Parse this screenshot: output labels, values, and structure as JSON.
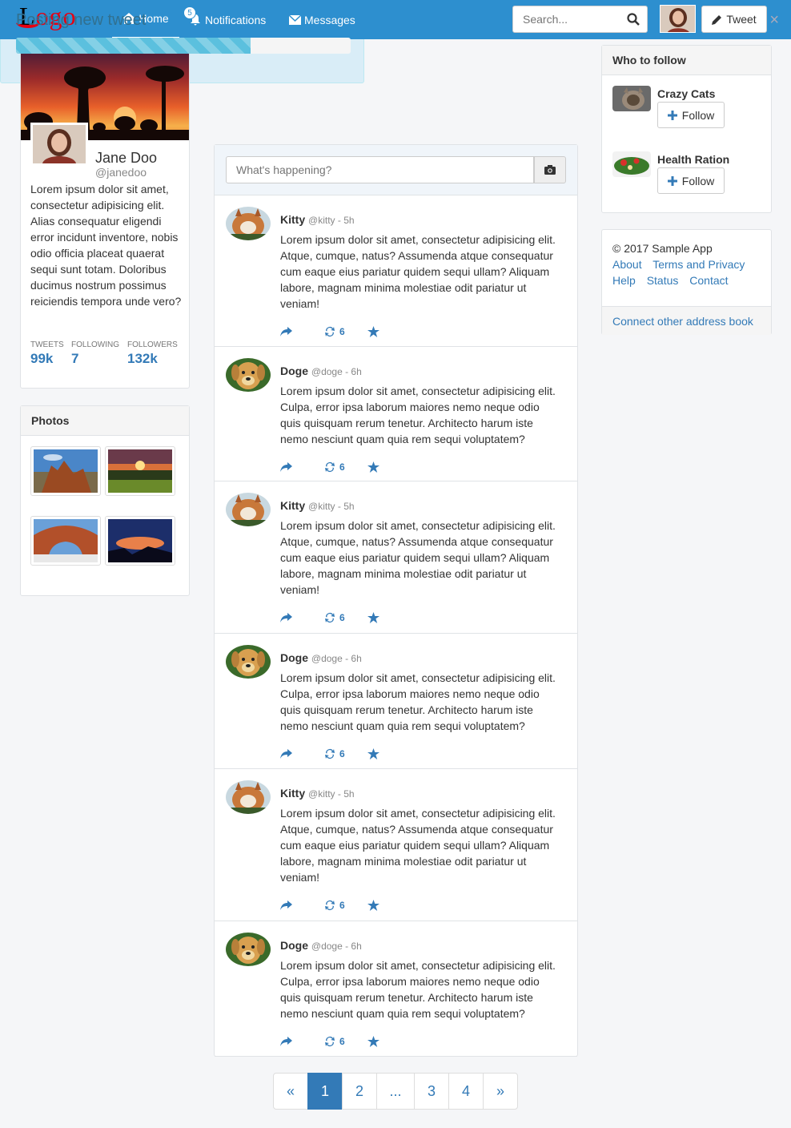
{
  "nav": {
    "logo_first": "L",
    "logo_rest": "ogo",
    "home": "Home",
    "notifications": "Notifications",
    "notifications_badge": "5",
    "messages": "Messages",
    "search_placeholder": "Search...",
    "tweet_button": "Tweet"
  },
  "profile": {
    "name": "Jane Doo",
    "handle": "@janedoo",
    "bio": "Lorem ipsum dolor sit amet, consectetur adipisicing elit. Alias consequatur eligendi error incidunt inventore, nobis odio officia placeat quaerat sequi sunt totam. Doloribus ducimus nostrum possimus reiciendis tempora unde vero?",
    "stats": [
      {
        "label": "TWEETS",
        "value": "99k"
      },
      {
        "label": "FOLLOWING",
        "value": "7"
      },
      {
        "label": "FOLLOWERS",
        "value": "132k"
      }
    ]
  },
  "photos": {
    "title": "Photos"
  },
  "posting": {
    "title": "Posting new tweet",
    "close": "×",
    "progress": 0.7
  },
  "compose": {
    "placeholder": "What's happening?"
  },
  "tweets": [
    {
      "author": "Kitty",
      "meta": "@kitty - 5h",
      "text": "Lorem ipsum dolor sit amet, consectetur adipisicing elit. Atque, cumque, natus? Assumenda atque consequatur cum eaque eius pariatur quidem sequi ullam? Aliquam labore, magnam minima molestiae odit pariatur ut veniam!",
      "retweets": "6"
    },
    {
      "author": "Doge",
      "meta": "@doge - 6h",
      "text": "Lorem ipsum dolor sit amet, consectetur adipisicing elit. Culpa, error ipsa laborum maiores nemo neque odio quis quisquam rerum tenetur. Architecto harum iste nemo nesciunt quam quia rem sequi voluptatem?",
      "retweets": "6"
    },
    {
      "author": "Kitty",
      "meta": "@kitty - 5h",
      "text": "Lorem ipsum dolor sit amet, consectetur adipisicing elit. Atque, cumque, natus? Assumenda atque consequatur cum eaque eius pariatur quidem sequi ullam? Aliquam labore, magnam minima molestiae odit pariatur ut veniam!",
      "retweets": "6"
    },
    {
      "author": "Doge",
      "meta": "@doge - 6h",
      "text": "Lorem ipsum dolor sit amet, consectetur adipisicing elit. Culpa, error ipsa laborum maiores nemo neque odio quis quisquam rerum tenetur. Architecto harum iste nemo nesciunt quam quia rem sequi voluptatem?",
      "retweets": "6"
    },
    {
      "author": "Kitty",
      "meta": "@kitty - 5h",
      "text": "Lorem ipsum dolor sit amet, consectetur adipisicing elit. Atque, cumque, natus? Assumenda atque consequatur cum eaque eius pariatur quidem sequi ullam? Aliquam labore, magnam minima molestiae odit pariatur ut veniam!",
      "retweets": "6"
    },
    {
      "author": "Doge",
      "meta": "@doge - 6h",
      "text": "Lorem ipsum dolor sit amet, consectetur adipisicing elit. Culpa, error ipsa laborum maiores nemo neque odio quis quisquam rerum tenetur. Architecto harum iste nemo nesciunt quam quia rem sequi voluptatem?",
      "retweets": "6"
    }
  ],
  "pagination": {
    "prev": "«",
    "pages": [
      "1",
      "2",
      "...",
      "3",
      "4"
    ],
    "next": "»",
    "active": "1"
  },
  "who_to_follow": {
    "title": "Who to follow",
    "items": [
      {
        "name": "Crazy Cats",
        "button": "Follow"
      },
      {
        "name": "Health Ration",
        "button": "Follow"
      }
    ]
  },
  "footer": {
    "copyright": "© 2017 Sample App",
    "links_row1": [
      "About",
      "Terms and Privacy"
    ],
    "links_row2": [
      "Help",
      "Status",
      "Contact"
    ],
    "connect": "Connect other address book"
  },
  "colors": {
    "navbar": "#2d8fcf",
    "link": "#337ab7",
    "logo_red": "#e60012"
  }
}
